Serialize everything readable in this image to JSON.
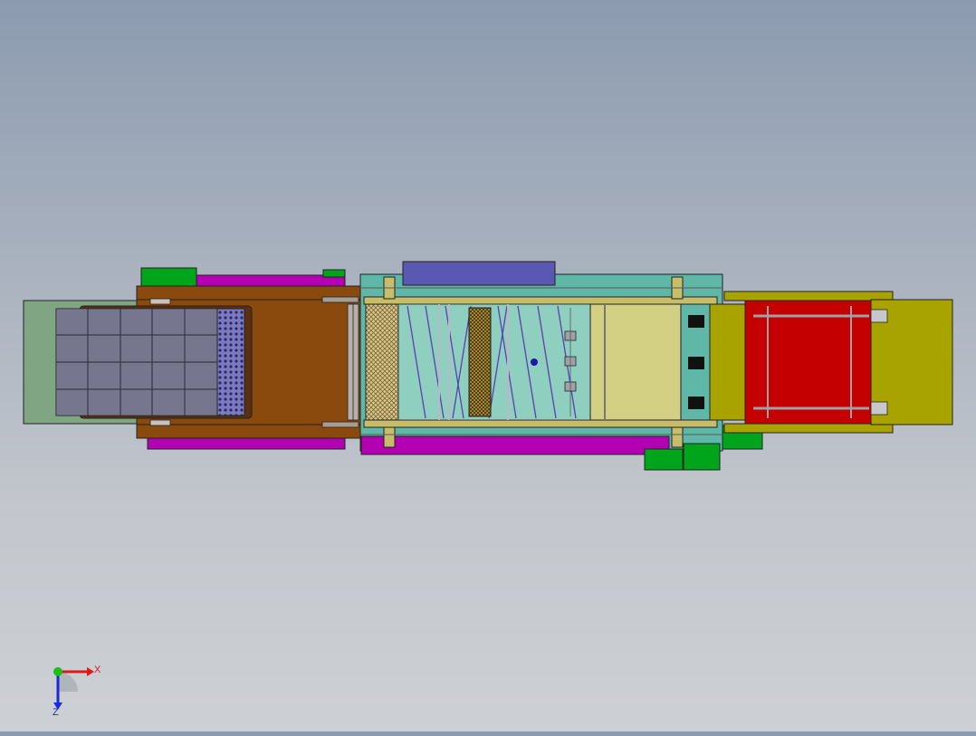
{
  "viewport": {
    "background_top": "#8c9bb0",
    "background_bottom": "#cdd0d4"
  },
  "model_parts": {
    "infeed_mat": "#7fa582",
    "grid_tray": "#6f6f86",
    "brown_conveyor": "#8b4a0d",
    "magenta_rail": "#b200b2",
    "green_block": "#00a51c",
    "teal_frame": "#5fb7a8",
    "blue_cover": "#5a58b3",
    "khaki_frame": "#c7bd6a",
    "mesh_belt": "#d4c08a",
    "red_outfeed": "#c40000",
    "olive_outfeed": "#a9a300"
  },
  "triad": {
    "x_label": "X",
    "z_label": "Z",
    "x_color": "#e01818",
    "y_color": "#18c018",
    "z_color": "#1a2ad8"
  }
}
